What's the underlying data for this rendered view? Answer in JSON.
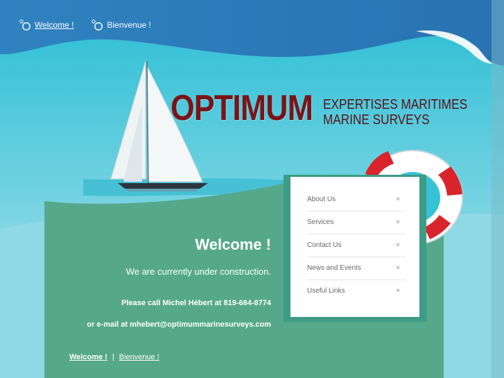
{
  "lang_bar": {
    "welcome_link": "Welcome !",
    "bienvenue_link": "Bienvenue !"
  },
  "logo": {
    "name": "OPTIMUM",
    "line1": "EXPERTISES MARITIMES",
    "line2": "MARINE SURVEYS"
  },
  "menu": {
    "items": [
      {
        "label": "About Us",
        "icon": "×"
      },
      {
        "label": "Services",
        "icon": "×"
      },
      {
        "label": "Contact Us",
        "icon": "×"
      },
      {
        "label": "News and Events",
        "icon": "×"
      },
      {
        "label": "Useful Links",
        "icon": "×"
      }
    ]
  },
  "main": {
    "title": "Welcome !",
    "construction": "We are currently under construction.",
    "call": "Please call Michel Hébert at 819-684-8774",
    "email": "or e-mail at mhebert@optimummarinesurveys.com"
  },
  "footer": {
    "welcome_link": "Welcome !",
    "separator": "|",
    "bienvenue_link": "Bienvenue !"
  },
  "colors": {
    "header_blue": "#2a7bb9",
    "wave_cyan": "#37c3d6",
    "panel_green": "#56a88a",
    "logo_red": "#7a1418"
  }
}
